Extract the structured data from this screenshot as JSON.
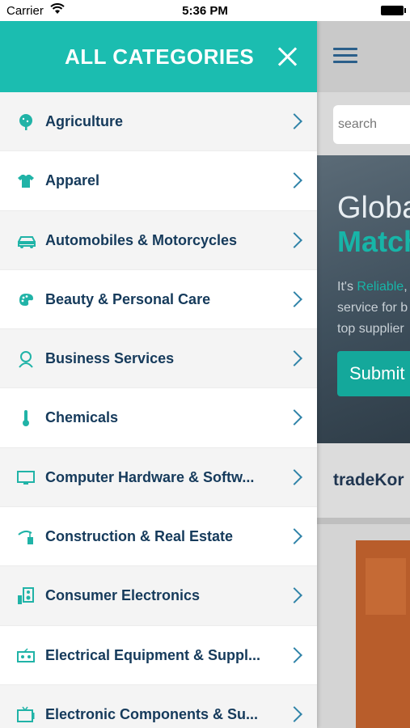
{
  "status": {
    "carrier": "Carrier",
    "time": "5:36 PM"
  },
  "drawer": {
    "title": "ALL CATEGORIES",
    "accent": "#1bbdb0",
    "categories": [
      {
        "label": "Agriculture",
        "icon": "tree-icon"
      },
      {
        "label": "Apparel",
        "icon": "tshirt-icon"
      },
      {
        "label": "Automobiles & Motorcycles",
        "icon": "car-icon"
      },
      {
        "label": "Beauty & Personal Care",
        "icon": "palette-icon"
      },
      {
        "label": "Business Services",
        "icon": "person-icon"
      },
      {
        "label": "Chemicals",
        "icon": "thermometer-icon"
      },
      {
        "label": "Computer Hardware & Softw...",
        "icon": "monitor-icon"
      },
      {
        "label": "Construction & Real Estate",
        "icon": "crane-icon"
      },
      {
        "label": "Consumer Electronics",
        "icon": "speaker-icon"
      },
      {
        "label": "Electrical Equipment & Suppl...",
        "icon": "radio-icon"
      },
      {
        "label": "Electronic Components & Su...",
        "icon": "tv-icon"
      }
    ]
  },
  "background": {
    "search_placeholder": "search",
    "hero_line1": "Globa",
    "hero_line2": "Match",
    "hero_text_prefix": "It's ",
    "hero_text_highlight": "Reliable",
    "hero_text_suffix": ",",
    "hero_text_line2": "service for b",
    "hero_text_line3": "top supplier",
    "submit_label": "Submit",
    "brand": "tradeKor"
  }
}
